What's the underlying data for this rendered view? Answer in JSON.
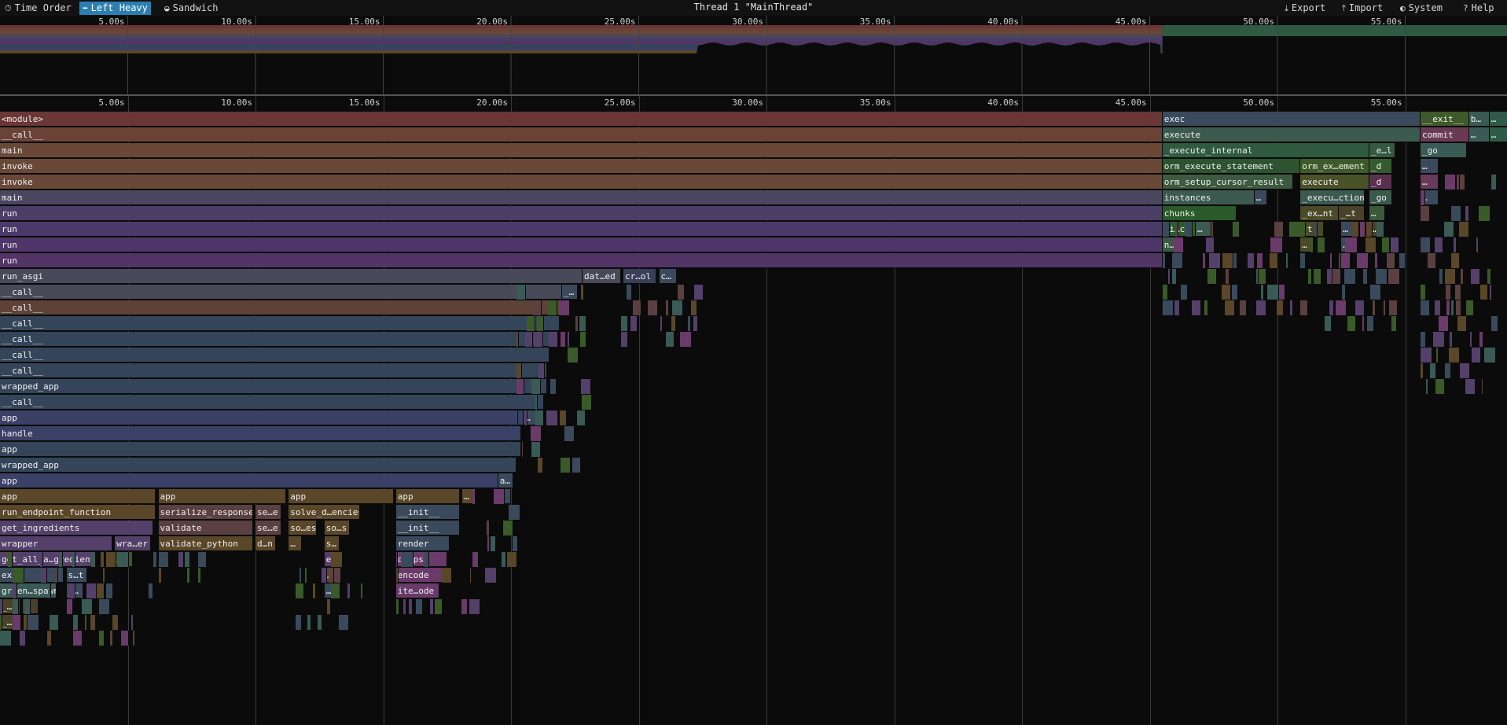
{
  "toolbar": {
    "time_order": "Time Order",
    "left_heavy": "Left Heavy",
    "sandwich": "Sandwich",
    "title": "Thread 1 \"MainThread\"",
    "export": "Export",
    "import": "Import",
    "system": "System",
    "help": "Help"
  },
  "ruler": [
    "5.00s",
    "10.00s",
    "15.00s",
    "20.00s",
    "25.00s",
    "30.00s",
    "35.00s",
    "40.00s",
    "45.00s",
    "50.00s",
    "55.00s"
  ],
  "frames": [
    {
      "d": 0,
      "s": 0,
      "e": 45.5,
      "t": "<module>",
      "c": "#6b3636"
    },
    {
      "d": 0,
      "s": 45.5,
      "e": 55.6,
      "t": "exec",
      "c": "#3a4a5c"
    },
    {
      "d": 0,
      "s": 55.6,
      "e": 57.5,
      "t": "__exit__",
      "c": "#3f5a2a"
    },
    {
      "d": 0,
      "s": 57.5,
      "e": 58.3,
      "t": "b…",
      "c": "#3a5a55"
    },
    {
      "d": 0,
      "s": 58.3,
      "e": 59.0,
      "t": "…",
      "c": "#2f5a4a"
    },
    {
      "d": 1,
      "s": 0,
      "e": 45.5,
      "t": "__call__",
      "c": "#6a4236"
    },
    {
      "d": 1,
      "s": 45.5,
      "e": 55.6,
      "t": "execute",
      "c": "#3c5a4f"
    },
    {
      "d": 1,
      "s": 55.6,
      "e": 57.5,
      "t": "commit",
      "c": "#6a3a55"
    },
    {
      "d": 1,
      "s": 57.5,
      "e": 58.3,
      "t": "…",
      "c": "#3a5a55"
    },
    {
      "d": 1,
      "s": 58.3,
      "e": 59.0,
      "t": "…",
      "c": "#2f5a4a"
    },
    {
      "d": 2,
      "s": 0,
      "e": 45.5,
      "t": "main",
      "c": "#6a4838"
    },
    {
      "d": 2,
      "s": 45.5,
      "e": 53.6,
      "t": "_execute_internal",
      "c": "#2f5a40"
    },
    {
      "d": 2,
      "s": 53.6,
      "e": 54.6,
      "t": "_e…l",
      "c": "#355a40"
    },
    {
      "d": 2,
      "s": 55.6,
      "e": 57.4,
      "t": "_go",
      "c": "#3a5a55"
    },
    {
      "d": 3,
      "s": 0,
      "e": 45.5,
      "t": "invoke",
      "c": "#6a4838"
    },
    {
      "d": 3,
      "s": 45.5,
      "e": 50.9,
      "t": "orm_execute_statement",
      "c": "#2d5330"
    },
    {
      "d": 3,
      "s": 50.9,
      "e": 53.6,
      "t": "orm_ex…ement",
      "c": "#3f5a2a"
    },
    {
      "d": 3,
      "s": 53.6,
      "e": 54.5,
      "t": "_d",
      "c": "#355a30"
    },
    {
      "d": 3,
      "s": 55.6,
      "e": 56.3,
      "t": "…",
      "c": "#3a4a5c"
    },
    {
      "d": 4,
      "s": 0,
      "e": 45.5,
      "t": "invoke",
      "c": "#6a4838"
    },
    {
      "d": 4,
      "s": 45.5,
      "e": 50.6,
      "t": "orm_setup_cursor_result",
      "c": "#3c5a40"
    },
    {
      "d": 4,
      "s": 50.9,
      "e": 53.6,
      "t": "execute",
      "c": "#4a5228"
    },
    {
      "d": 4,
      "s": 53.6,
      "e": 54.5,
      "t": "_d",
      "c": "#5a3050"
    },
    {
      "d": 4,
      "s": 55.6,
      "e": 56.3,
      "t": "…",
      "c": "#6a3a5a"
    },
    {
      "d": 5,
      "s": 0,
      "e": 45.5,
      "t": "main",
      "c": "#4a4660"
    },
    {
      "d": 5,
      "s": 45.5,
      "e": 49.1,
      "t": "instances",
      "c": "#3c5a4f"
    },
    {
      "d": 5,
      "s": 49.1,
      "e": 49.6,
      "t": "…",
      "c": "#3a4a5c"
    },
    {
      "d": 5,
      "s": 50.9,
      "e": 53.4,
      "t": "_execu…ction",
      "c": "#3c5a4f"
    },
    {
      "d": 5,
      "s": 53.6,
      "e": 54.5,
      "t": "_go",
      "c": "#3a5a4a"
    },
    {
      "d": 5,
      "s": 55.6,
      "e": 56.3,
      "t": "…",
      "c": "#3a4a5c"
    },
    {
      "d": 6,
      "s": 0,
      "e": 45.5,
      "t": "run",
      "c": "#4a3e66"
    },
    {
      "d": 6,
      "s": 45.5,
      "e": 48.4,
      "t": "chunks",
      "c": "#2a5a2a"
    },
    {
      "d": 6,
      "s": 50.9,
      "e": 52.4,
      "t": "_ex…nt",
      "c": "#4a4a28"
    },
    {
      "d": 6,
      "s": 52.4,
      "e": 53.4,
      "t": "_…t",
      "c": "#4a4228"
    },
    {
      "d": 6,
      "s": 53.6,
      "e": 54.2,
      "t": "…",
      "c": "#3a5a3a"
    },
    {
      "d": 7,
      "s": 0,
      "e": 45.5,
      "t": "run",
      "c": "#4a3a6a"
    },
    {
      "d": 7,
      "s": 45.5,
      "e": 46.8,
      "t": "_i…ce",
      "c": "#2f5a30"
    },
    {
      "d": 7,
      "s": 46.8,
      "e": 47.4,
      "t": "…",
      "c": "#3c5a4f"
    },
    {
      "d": 7,
      "s": 50.9,
      "e": 51.8,
      "t": "_t",
      "c": "#4a4a28"
    },
    {
      "d": 7,
      "s": 52.5,
      "e": 53.2,
      "t": "…",
      "c": "#3a4a5c"
    },
    {
      "d": 7,
      "s": 53.6,
      "e": 54.1,
      "t": "…",
      "c": "#4a4228"
    },
    {
      "d": 8,
      "s": 0,
      "e": 45.5,
      "t": "run",
      "c": "#4e366a"
    },
    {
      "d": 8,
      "s": 45.5,
      "e": 46.2,
      "t": "n…",
      "c": "#3a5a45"
    },
    {
      "d": 8,
      "s": 50.9,
      "e": 51.4,
      "t": "…",
      "c": "#4a4a28"
    },
    {
      "d": 8,
      "s": 52.5,
      "e": 53.1,
      "t": "…",
      "c": "#3a4a5c"
    },
    {
      "d": 9,
      "s": 0,
      "e": 45.5,
      "t": "run",
      "c": "#523466"
    },
    {
      "d": 10,
      "s": 0,
      "e": 22.8,
      "t": "run_asgi",
      "c": "#484a5a"
    },
    {
      "d": 10,
      "s": 22.8,
      "e": 24.3,
      "t": "dat…ed",
      "c": "#484a5a"
    },
    {
      "d": 10,
      "s": 24.4,
      "e": 25.7,
      "t": "cr…ol",
      "c": "#3a3f5a"
    },
    {
      "d": 10,
      "s": 25.8,
      "e": 26.5,
      "t": "c…",
      "c": "#3a4a5c"
    },
    {
      "d": 11,
      "s": 0,
      "e": 22.0,
      "t": "__call__",
      "c": "#484a5a"
    },
    {
      "d": 11,
      "s": 22.0,
      "e": 22.6,
      "t": "_…",
      "c": "#3a4a5c"
    },
    {
      "d": 12,
      "s": 0,
      "e": 21.9,
      "t": "__call__",
      "c": "#5e4238"
    },
    {
      "d": 13,
      "s": 0,
      "e": 21.9,
      "t": "__call__",
      "c": "#34455a"
    },
    {
      "d": 14,
      "s": 0,
      "e": 21.8,
      "t": "__call__",
      "c": "#34455a"
    },
    {
      "d": 15,
      "s": 0,
      "e": 21.5,
      "t": "__call__",
      "c": "#34455a"
    },
    {
      "d": 16,
      "s": 0,
      "e": 21.4,
      "t": "__call__",
      "c": "#34455a"
    },
    {
      "d": 17,
      "s": 0,
      "e": 21.4,
      "t": "wrapped_app",
      "c": "#34455a"
    },
    {
      "d": 18,
      "s": 0,
      "e": 21.3,
      "t": "__call__",
      "c": "#34455a"
    },
    {
      "d": 19,
      "s": 0,
      "e": 20.5,
      "t": "app",
      "c": "#3a4066"
    },
    {
      "d": 19,
      "s": 20.5,
      "e": 21.1,
      "t": "…",
      "c": "#3a4a5c"
    },
    {
      "d": 20,
      "s": 0,
      "e": 20.4,
      "t": "handle",
      "c": "#3a4066"
    },
    {
      "d": 21,
      "s": 0,
      "e": 20.4,
      "t": "app",
      "c": "#34455a"
    },
    {
      "d": 22,
      "s": 0,
      "e": 20.2,
      "t": "wrapped_app",
      "c": "#34455a"
    },
    {
      "d": 23,
      "s": 0,
      "e": 19.5,
      "t": "app",
      "c": "#3a4066"
    },
    {
      "d": 23,
      "s": 19.5,
      "e": 20.1,
      "t": "a…",
      "c": "#3a4a5c"
    },
    {
      "d": 24,
      "s": 0,
      "e": 6.1,
      "t": "app",
      "c": "#5a4628"
    },
    {
      "d": 24,
      "s": 6.2,
      "e": 11.2,
      "t": "app",
      "c": "#5a4628"
    },
    {
      "d": 24,
      "s": 11.3,
      "e": 15.4,
      "t": "app",
      "c": "#5a4628"
    },
    {
      "d": 24,
      "s": 15.5,
      "e": 18.0,
      "t": "app",
      "c": "#5a4628"
    },
    {
      "d": 24,
      "s": 18.1,
      "e": 18.6,
      "t": "…",
      "c": "#5a4628"
    },
    {
      "d": 24,
      "s": 19.5,
      "e": 20.0,
      "t": "…",
      "c": "#3a4a5c"
    },
    {
      "d": 25,
      "s": 0,
      "e": 6.1,
      "t": "run_endpoint_function",
      "c": "#5a4628"
    },
    {
      "d": 25,
      "s": 6.2,
      "e": 9.9,
      "t": "serialize_response",
      "c": "#5a4040"
    },
    {
      "d": 25,
      "s": 10.0,
      "e": 11.0,
      "t": "se…e",
      "c": "#5a4040"
    },
    {
      "d": 25,
      "s": 11.3,
      "e": 14.1,
      "t": "solve_d…encies",
      "c": "#5a4628"
    },
    {
      "d": 25,
      "s": 15.5,
      "e": 18.0,
      "t": "__init__",
      "c": "#3a4a5c"
    },
    {
      "d": 26,
      "s": 0,
      "e": 6.0,
      "t": "get_ingredients",
      "c": "#54406a"
    },
    {
      "d": 26,
      "s": 6.2,
      "e": 9.9,
      "t": "validate",
      "c": "#5a4040"
    },
    {
      "d": 26,
      "s": 10.0,
      "e": 11.0,
      "t": "se…e",
      "c": "#5a4040"
    },
    {
      "d": 26,
      "s": 11.3,
      "e": 12.4,
      "t": "so…es",
      "c": "#5a4628"
    },
    {
      "d": 26,
      "s": 12.7,
      "e": 13.7,
      "t": "so…s",
      "c": "#5a4628"
    },
    {
      "d": 26,
      "s": 15.5,
      "e": 18.0,
      "t": "__init__",
      "c": "#3a4a5c"
    },
    {
      "d": 27,
      "s": 0,
      "e": 4.4,
      "t": "wrapper",
      "c": "#54406a"
    },
    {
      "d": 27,
      "s": 4.5,
      "e": 5.9,
      "t": "wra…er",
      "c": "#54406a"
    },
    {
      "d": 27,
      "s": 6.2,
      "e": 9.9,
      "t": "validate_python",
      "c": "#5a4628"
    },
    {
      "d": 27,
      "s": 10.0,
      "e": 10.8,
      "t": "d…n",
      "c": "#5a4628"
    },
    {
      "d": 27,
      "s": 11.3,
      "e": 11.8,
      "t": "…",
      "c": "#5a4628"
    },
    {
      "d": 27,
      "s": 12.7,
      "e": 13.3,
      "t": "s…",
      "c": "#5a4628"
    },
    {
      "d": 27,
      "s": 15.5,
      "e": 17.6,
      "t": "render",
      "c": "#3a4a5c"
    },
    {
      "d": 28,
      "s": 0,
      "e": 3.6,
      "t": "get_all_a…gredients",
      "c": "#54406a"
    },
    {
      "d": 28,
      "s": 4.5,
      "e": 5.2,
      "t": "…",
      "c": "#3a5a2a"
    },
    {
      "d": 28,
      "s": 12.7,
      "e": 13.3,
      "t": "e…",
      "c": "#5a3a66"
    },
    {
      "d": 28,
      "s": 15.5,
      "e": 17.5,
      "t": "dumps",
      "c": "#6a3a6a"
    },
    {
      "d": 29,
      "s": 0,
      "e": 2.5,
      "t": "exec",
      "c": "#3a4a5c"
    },
    {
      "d": 29,
      "s": 2.6,
      "e": 3.4,
      "t": "s…t",
      "c": "#3a4a5c"
    },
    {
      "d": 29,
      "s": 12.7,
      "e": 13.3,
      "t": "…",
      "c": "#5a3a66"
    },
    {
      "d": 29,
      "s": 15.5,
      "e": 17.5,
      "t": "encode",
      "c": "#6a3a6a"
    },
    {
      "d": 30,
      "s": 0,
      "e": 2.2,
      "t": "green…spawn",
      "c": "#3a5a55"
    },
    {
      "d": 30,
      "s": 2.6,
      "e": 3.2,
      "t": "_…",
      "c": "#3a4a5c"
    },
    {
      "d": 30,
      "s": 12.7,
      "e": 13.3,
      "t": "…",
      "c": "#3a4a5c"
    },
    {
      "d": 30,
      "s": 15.5,
      "e": 17.2,
      "t": "ite…ode",
      "c": "#6a3a6a"
    },
    {
      "d": 31,
      "s": 0,
      "e": 0.8,
      "t": "_…e",
      "c": "#4a4228"
    },
    {
      "d": 31,
      "s": 0.9,
      "e": 1.5,
      "t": "…",
      "c": "#4a4228"
    },
    {
      "d": 32,
      "s": 0,
      "e": 0.6,
      "t": "_…",
      "c": "#4a4228"
    }
  ]
}
